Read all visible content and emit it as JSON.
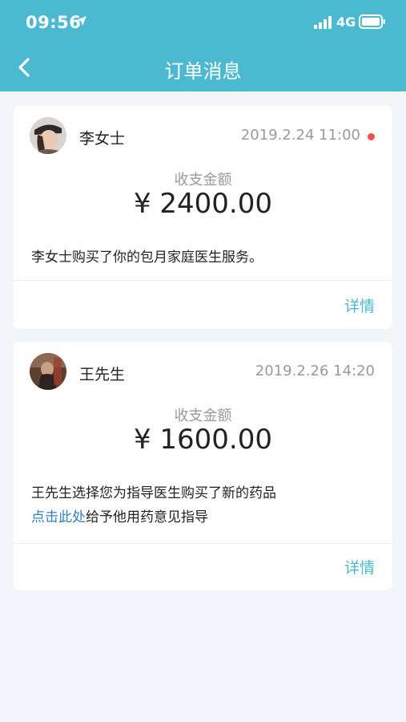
{
  "status_bar": {
    "time": "09:56",
    "network": "4G"
  },
  "nav": {
    "title": "订单消息"
  },
  "colors": {
    "accent": "#4bbad0",
    "unread": "#f0524c",
    "link": "#2f7fc2"
  },
  "messages": [
    {
      "user": "李女士",
      "time": "2019.2.24 11:00",
      "unread": true,
      "amount_label": "收支金额",
      "amount": "¥ 2400.00",
      "description": "李女士购买了你的包月家庭医生服务。",
      "detail_label": "详情"
    },
    {
      "user": "王先生",
      "time": "2019.2.26 14:20",
      "unread": false,
      "amount_label": "收支金额",
      "amount": "¥ 1600.00",
      "description_line1": "王先生选择您为指导医生购买了新的药品",
      "description_link": "点击此处",
      "description_link_suffix": "给予他用药意见指导",
      "detail_label": "详情"
    }
  ]
}
